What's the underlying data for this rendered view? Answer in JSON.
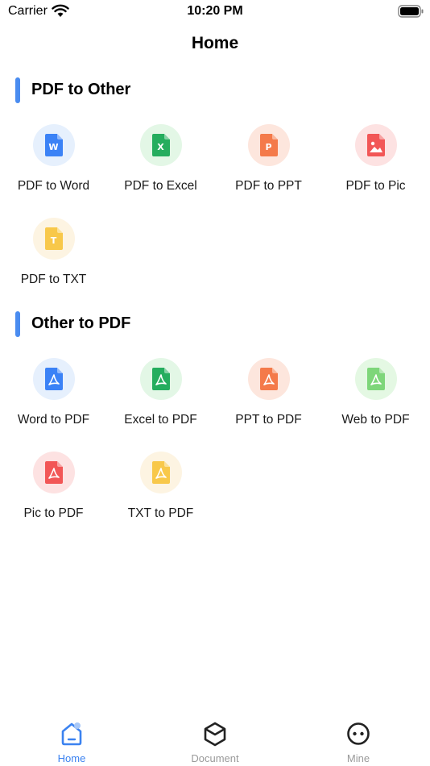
{
  "status_bar": {
    "carrier": "Carrier",
    "time": "10:20 PM"
  },
  "nav": {
    "title": "Home"
  },
  "sections": [
    {
      "title": "PDF to Other",
      "tools": [
        {
          "label": "PDF to Word",
          "bg": "#e6f0fd",
          "fg": "#3b82f6",
          "glyph": "W"
        },
        {
          "label": "PDF to Excel",
          "bg": "#e3f7e6",
          "fg": "#25ad5e",
          "glyph": "X"
        },
        {
          "label": "PDF to PPT",
          "bg": "#fde6dd",
          "fg": "#f47a4a",
          "glyph": "P"
        },
        {
          "label": "PDF to Pic",
          "bg": "#fde2e2",
          "fg": "#f25656",
          "glyph": "pic"
        },
        {
          "label": "PDF to TXT",
          "bg": "#fdf4e2",
          "fg": "#f8c84a",
          "glyph": "T"
        }
      ]
    },
    {
      "title": "Other to PDF",
      "tools": [
        {
          "label": "Word to PDF",
          "bg": "#e6f0fd",
          "fg": "#3b82f6",
          "glyph": "pdf"
        },
        {
          "label": "Excel to PDF",
          "bg": "#e3f7e6",
          "fg": "#25ad5e",
          "glyph": "pdf"
        },
        {
          "label": "PPT to PDF",
          "bg": "#fde6dd",
          "fg": "#f47a4a",
          "glyph": "pdf"
        },
        {
          "label": "Web to PDF",
          "bg": "#e4f8e3",
          "fg": "#7ed67a",
          "glyph": "pdf"
        },
        {
          "label": "Pic to PDF",
          "bg": "#fde2e2",
          "fg": "#f25656",
          "glyph": "pdf"
        },
        {
          "label": "TXT to PDF",
          "bg": "#fdf4e2",
          "fg": "#f8c84a",
          "glyph": "pdf"
        }
      ]
    }
  ],
  "tabs": [
    {
      "label": "Home",
      "icon": "home-icon",
      "active": true
    },
    {
      "label": "Document",
      "icon": "document-icon",
      "active": false
    },
    {
      "label": "Mine",
      "icon": "mine-icon",
      "active": false
    }
  ],
  "colors": {
    "accent": "#3b82f0",
    "section_bar": "#4a8cf0",
    "tab_inactive": "#9a9a9a"
  }
}
